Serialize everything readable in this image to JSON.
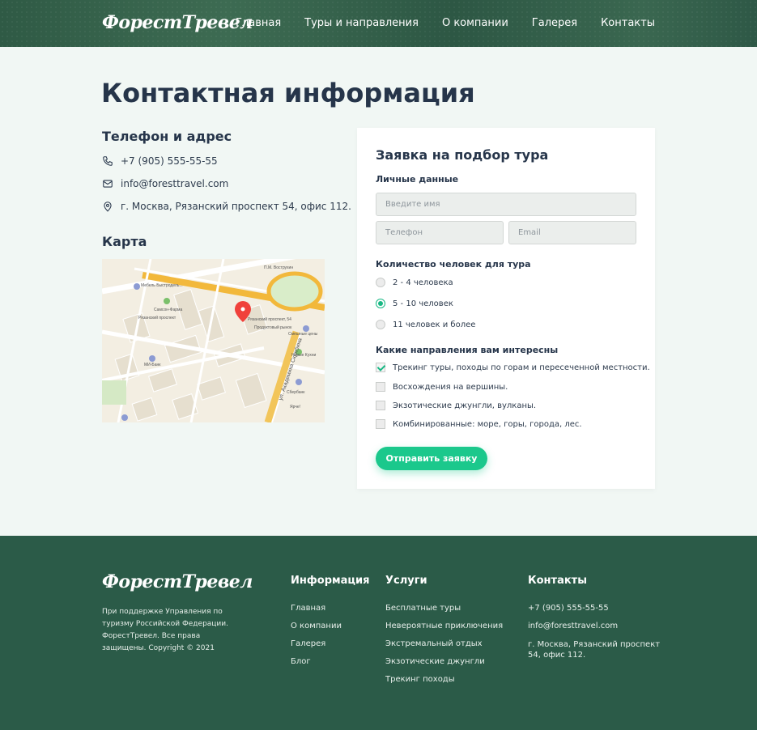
{
  "header": {
    "logo": "ФорестТревел",
    "nav": [
      "Главная",
      "Туры и направления",
      "О компании",
      "Галерея",
      "Контакты"
    ]
  },
  "page": {
    "title": "Контактная информация"
  },
  "contacts": {
    "title": "Телефон и адрес",
    "phone": "+7 (905) 555-55-55",
    "email": "info@foresttravel.com",
    "address": "г. Москва, Рязанский проспект 54, офис 112."
  },
  "map": {
    "title": "Карта",
    "labels": {
      "pin": "Рязанский проспект, 54",
      "street": "ул. Академика Скрябина",
      "metro": "Рязанский проспект",
      "market": "Продуктовый рынок",
      "mall": "Смешные цены",
      "kitchen": "Новые Кухни",
      "bank": "Сбербанк",
      "pharmacy": "Самсон-Фарма",
      "shop": "Мебель Быстродель...",
      "mvideo": "МИ-Банк",
      "yarche": "Ярче!",
      "vostr": "П.М. Вострухин"
    }
  },
  "form": {
    "title": "Заявка на подбор тура",
    "personal_title": "Личные данные",
    "name_placeholder": "Введите имя",
    "phone_placeholder": "Телефон",
    "email_placeholder": "Email",
    "people_title": "Количество человек для тура",
    "people_options": [
      "2 - 4 человека",
      "5 - 10 человек",
      "11 человек и более"
    ],
    "people_selected": 1,
    "directions_title": "Какие направления вам интересны",
    "directions": [
      "Трекинг туры, походы по горам и пересеченной местности.",
      "Восхождения на вершины.",
      "Экзотические джунгли, вулканы.",
      "Комбинированные: море, горы, города, лес."
    ],
    "directions_checked": [
      0
    ],
    "submit": "Отправить заявку"
  },
  "footer": {
    "logo": "ФорестТревел",
    "description": "При поддержке Управления по туризму Российской Федерации. ФорестТревел. Все права защищены. Copyright © 2021",
    "info_title": "Информация",
    "info_links": [
      "Главная",
      "О компании",
      "Галерея",
      "Блог"
    ],
    "services_title": "Услуги",
    "services_links": [
      "Бесплатные туры",
      "Невероятные приключения",
      "Экстремальный отдых",
      "Экзотические джунгли",
      "Трекинг походы"
    ],
    "contacts_title": "Контакты",
    "phone": "+7 (905) 555-55-55",
    "email": "info@foresttravel.com",
    "address": "г. Москва, Рязанский проспект 54, офис 112."
  }
}
